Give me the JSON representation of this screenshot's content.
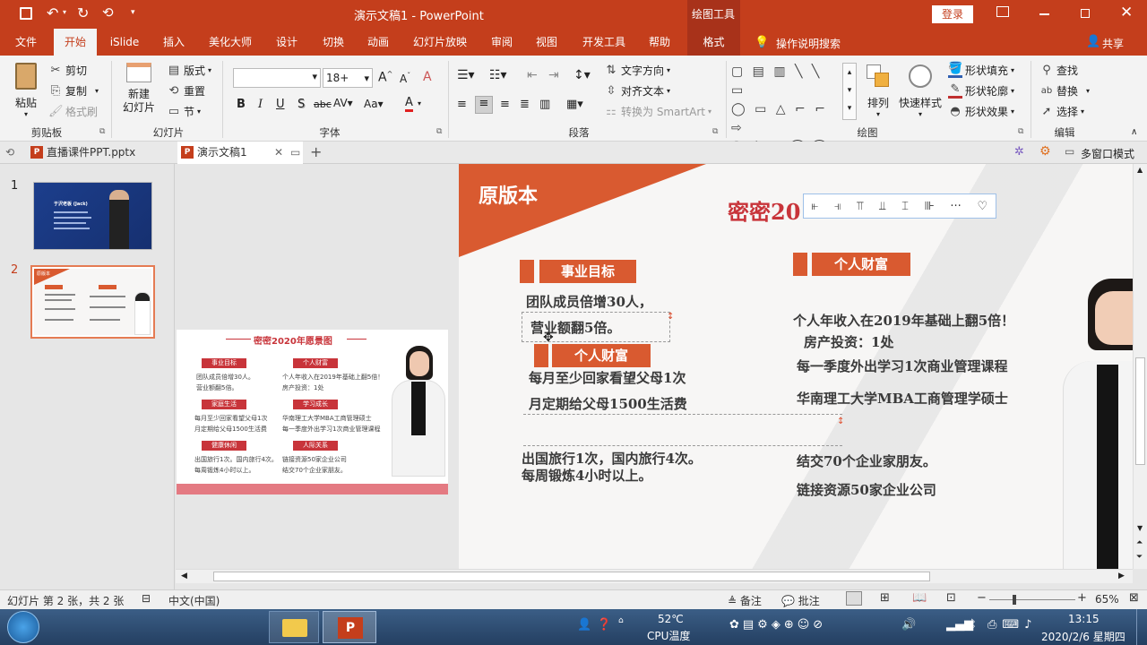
{
  "titlebar": {
    "title": "演示文稿1  -  PowerPoint",
    "context_tab": "绘图工具",
    "login": "登录"
  },
  "tabs": [
    "文件",
    "开始",
    "iSlide",
    "插入",
    "美化大师",
    "设计",
    "切换",
    "动画",
    "幻灯片放映",
    "审阅",
    "视图",
    "开发工具",
    "帮助",
    "格式"
  ],
  "tell_me": "操作说明搜索",
  "share": "共享",
  "clipboard": {
    "paste": "粘贴",
    "cut": "剪切",
    "copy": "复制",
    "format_painter": "格式刷",
    "label": "剪贴板"
  },
  "slides_group": {
    "new_slide": "新建\n幻灯片",
    "layout": "版式",
    "reset": "重置",
    "section": "节",
    "label": "幻灯片"
  },
  "font_group": {
    "font_name": "",
    "font_size": "18+",
    "label": "字体"
  },
  "paragraph_group": {
    "text_direction": "文字方向",
    "align_text": "对齐文本",
    "smartart": "转换为 SmartArt",
    "label": "段落"
  },
  "drawing_group": {
    "arrange": "排列",
    "quick_styles": "快速样式",
    "shape_fill": "形状填充",
    "shape_outline": "形状轮廓",
    "shape_effects": "形状效果",
    "label": "绘图"
  },
  "editing_group": {
    "find": "查找",
    "replace": "替换",
    "select": "选择",
    "label": "编辑"
  },
  "doc_tabs": [
    "直播课件PPT.pptx",
    "演示文稿1"
  ],
  "multiwindow": "多窗口模式",
  "thumbs": [
    {
      "num": "1",
      "title": "于沢老板 (Jack)"
    },
    {
      "num": "2",
      "title": "原版本"
    }
  ],
  "preview": {
    "title": "密密2020年愿景图",
    "sections": [
      {
        "label": "事业目标",
        "lines": [
          "团队成员倍增30人。",
          "营业额翻5倍。"
        ]
      },
      {
        "label": "个人财富",
        "lines": [
          "个人年收入在2019年基础上翻5倍！",
          "房产投资：1处"
        ]
      },
      {
        "label": "家庭生活",
        "lines": [
          "每月至少回家看望父母1次",
          "月定期给父母1500生活费"
        ]
      },
      {
        "label": "学习成长",
        "lines": [
          "华南理工大学MBA工商管理硕士",
          "每一季度外出学习1次商业管理课程"
        ]
      },
      {
        "label": "健康休闲",
        "lines": [
          "出国旅行1次。国内旅行4次。",
          "每周锻炼4小时以上。"
        ]
      },
      {
        "label": "人际关系",
        "lines": [
          "链接资源50家企业公司",
          "结交70个企业家朋友。"
        ]
      }
    ]
  },
  "slide": {
    "corner_title": "原版本",
    "main_title": "密密20",
    "sec1": "事业目标",
    "sec2": "个人财富",
    "sec3": "个人财富",
    "left_lines": [
      "团队成员倍增30人，",
      "营业额翻5倍。",
      "每月至少回家看望父母1次",
      "月定期给父母1500生活费",
      "出国旅行1次，国内旅行4次。",
      "每周锻炼4小时以上。"
    ],
    "right_lines": [
      "个人年收入在2019年基础上翻5倍！",
      "房产投资：1处",
      "每一季度外出学习1次商业管理课程",
      "华南理工大学MBA工商管理学硕士",
      "结交70个企业家朋友。",
      "链接资源50家企业公司"
    ]
  },
  "status": {
    "slide_info": "幻灯片 第 2 张，共 2 张",
    "language": "中文(中国)",
    "notes": "备注",
    "comments": "批注",
    "zoom": "65%"
  },
  "taskbar": {
    "temp": "52℃",
    "cpu": "CPU温度",
    "time": "13:15",
    "date": "2020/2/6 星期四"
  }
}
